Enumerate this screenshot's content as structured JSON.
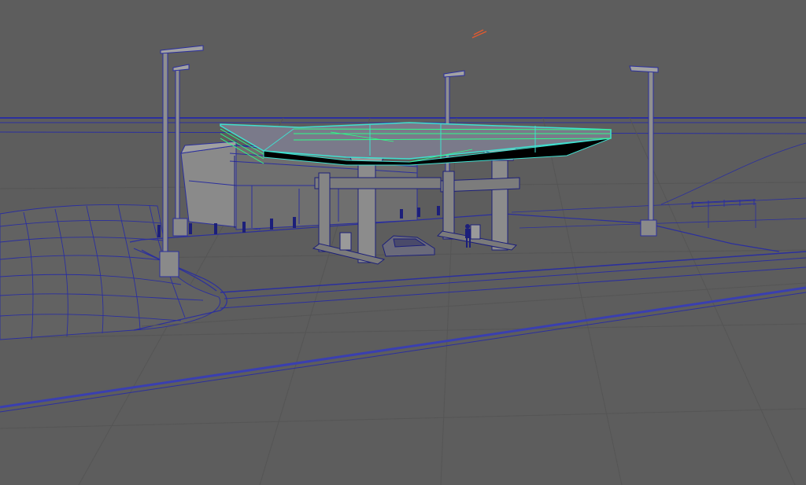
{
  "viewport": {
    "background": "#5d5d5d",
    "colors": {
      "wire": "#2b2f9e",
      "wire_dark": "#1c1f7a",
      "selection": "#40e0d0",
      "selection_highlight": "#2cff88",
      "mesh_fill": "#6e6e6e",
      "canopy_underside": "#000000",
      "axis_marker": "#e05a30"
    }
  },
  "scene": {
    "selected_object": "canopy",
    "objects": [
      {
        "id": "ground-grid",
        "icon": "ground-plane"
      },
      {
        "id": "terrain-hill",
        "icon": "terrain-mesh"
      },
      {
        "id": "road",
        "icon": "road-mesh"
      },
      {
        "id": "sidewalk-curb",
        "icon": "curb-mesh"
      },
      {
        "id": "convenience-store",
        "icon": "building-mesh"
      },
      {
        "id": "canopy",
        "icon": "canopy-mesh"
      },
      {
        "id": "support-pillar",
        "count": 2,
        "icon": "pillar-mesh"
      },
      {
        "id": "fuel-pump",
        "count": 4,
        "icon": "pump-mesh"
      },
      {
        "id": "car",
        "icon": "car-mesh"
      },
      {
        "id": "person",
        "icon": "person-mesh"
      },
      {
        "id": "street-lamp",
        "count": 4,
        "icon": "lamp-mesh"
      },
      {
        "id": "bollard",
        "icon": "bollard-mesh"
      },
      {
        "id": "fence",
        "icon": "fence-mesh"
      }
    ]
  }
}
